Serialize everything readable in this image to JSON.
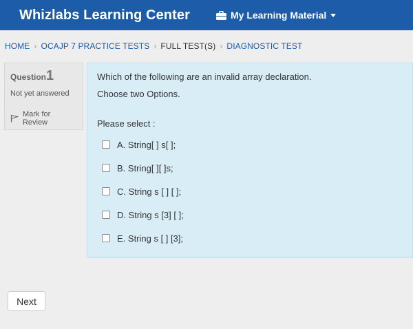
{
  "navbar": {
    "brand": "Whizlabs Learning Center",
    "menu_label": "My Learning Material",
    "menu_icon": "briefcase-icon"
  },
  "breadcrumb": [
    {
      "label": "HOME"
    },
    {
      "label": "OCAJP 7 PRACTICE TESTS"
    },
    {
      "label": "FULL TEST(S)"
    },
    {
      "label": "DIAGNOSTIC TEST"
    }
  ],
  "question_panel": {
    "label": "Question",
    "number": "1",
    "status": "Not yet answered",
    "mark_label": "Mark for Review"
  },
  "question": {
    "text": "Which of the following are an invalid array declaration.",
    "subtext": "Choose two Options.",
    "prompt": "Please select :",
    "options": [
      {
        "label": "A. String[ ] s[ ];",
        "checked": false
      },
      {
        "label": "B. String[ ][ ]s;",
        "checked": false
      },
      {
        "label": "C. String s [ ] [ ];",
        "checked": false
      },
      {
        "label": "D. String s [3] [ ];",
        "checked": false
      },
      {
        "label": "E. String s [ ] [3];",
        "checked": false
      }
    ]
  },
  "footer": {
    "next_label": "Next"
  },
  "colors": {
    "navbar": "#1c5ca8",
    "content_bg": "#d9edf7",
    "page_bg": "#eeeeee"
  }
}
